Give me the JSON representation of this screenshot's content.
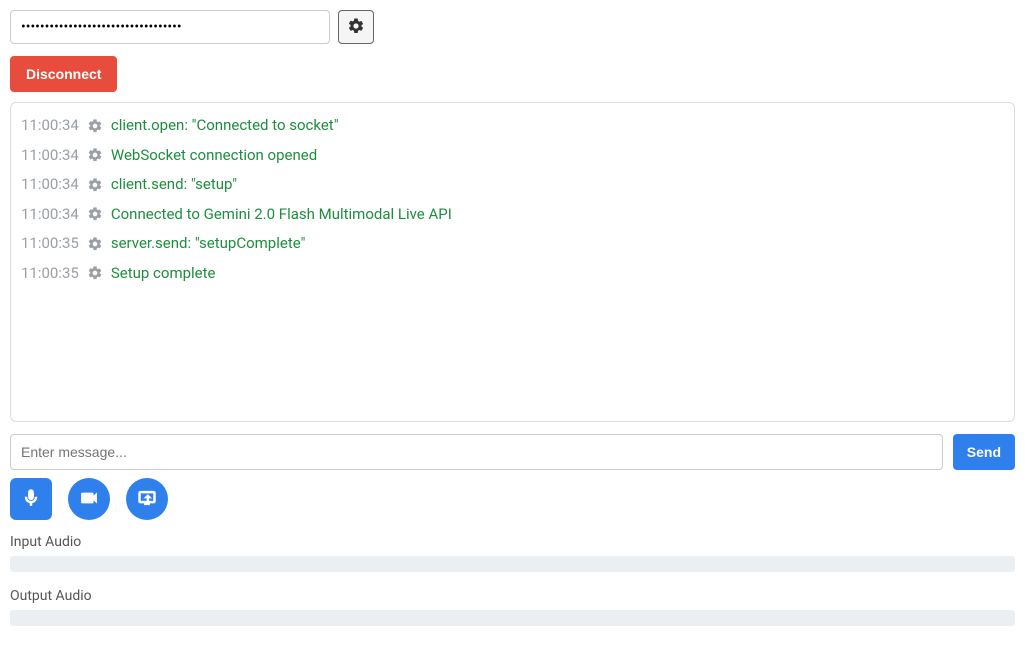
{
  "top": {
    "api_key_value": "••••••••••••••••••••••••••••••••••",
    "api_key_placeholder": ""
  },
  "buttons": {
    "disconnect": "Disconnect",
    "send": "Send"
  },
  "log": [
    {
      "time": "11:00:34",
      "msg": "client.open: \"Connected to socket\""
    },
    {
      "time": "11:00:34",
      "msg": "WebSocket connection opened"
    },
    {
      "time": "11:00:34",
      "msg": "client.send: \"setup\""
    },
    {
      "time": "11:00:34",
      "msg": "Connected to Gemini 2.0 Flash Multimodal Live API"
    },
    {
      "time": "11:00:35",
      "msg": "server.send: \"setupComplete\""
    },
    {
      "time": "11:00:35",
      "msg": "Setup complete"
    }
  ],
  "message": {
    "placeholder": "Enter message...",
    "value": ""
  },
  "audio": {
    "input_label": "Input Audio",
    "output_label": "Output Audio"
  }
}
